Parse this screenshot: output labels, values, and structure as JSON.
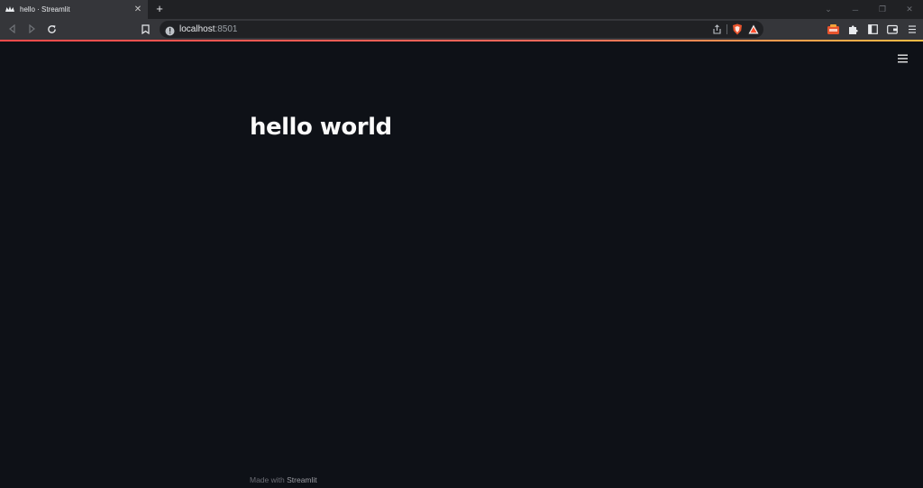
{
  "browser": {
    "tab": {
      "title": "hello · Streamlit",
      "close_glyph": "✕"
    },
    "new_tab_glyph": "+",
    "window_controls": [
      "⌄",
      "─",
      "❐",
      "✕"
    ],
    "address": {
      "host": "localhost",
      "port": ":8501"
    },
    "icons": {
      "favicon": "streamlit-crown-icon",
      "back": "back-icon",
      "forward": "forward-icon",
      "reload": "reload-icon",
      "bookmark": "bookmark-icon",
      "site_info": "site-info-icon",
      "share": "share-icon",
      "shields": "brave-shields-icon",
      "rewards": "brave-rewards-icon",
      "wallet_ext": "extension-wallet-icon",
      "extensions": "puzzle-icon",
      "sidebar": "sidebar-icon",
      "wallet": "wallet-icon",
      "menu": "menu-icon"
    },
    "loading_bar_colors": [
      "#ff4b4b",
      "#ffbd45"
    ]
  },
  "app": {
    "title": "hello world",
    "menu_icon": "hamburger-icon",
    "footer": {
      "prefix": "Made with ",
      "brand": "Streamlit"
    }
  },
  "colors": {
    "app_background": "#0e1117",
    "text": "#fafafa",
    "accent": "#ff4b4b"
  }
}
